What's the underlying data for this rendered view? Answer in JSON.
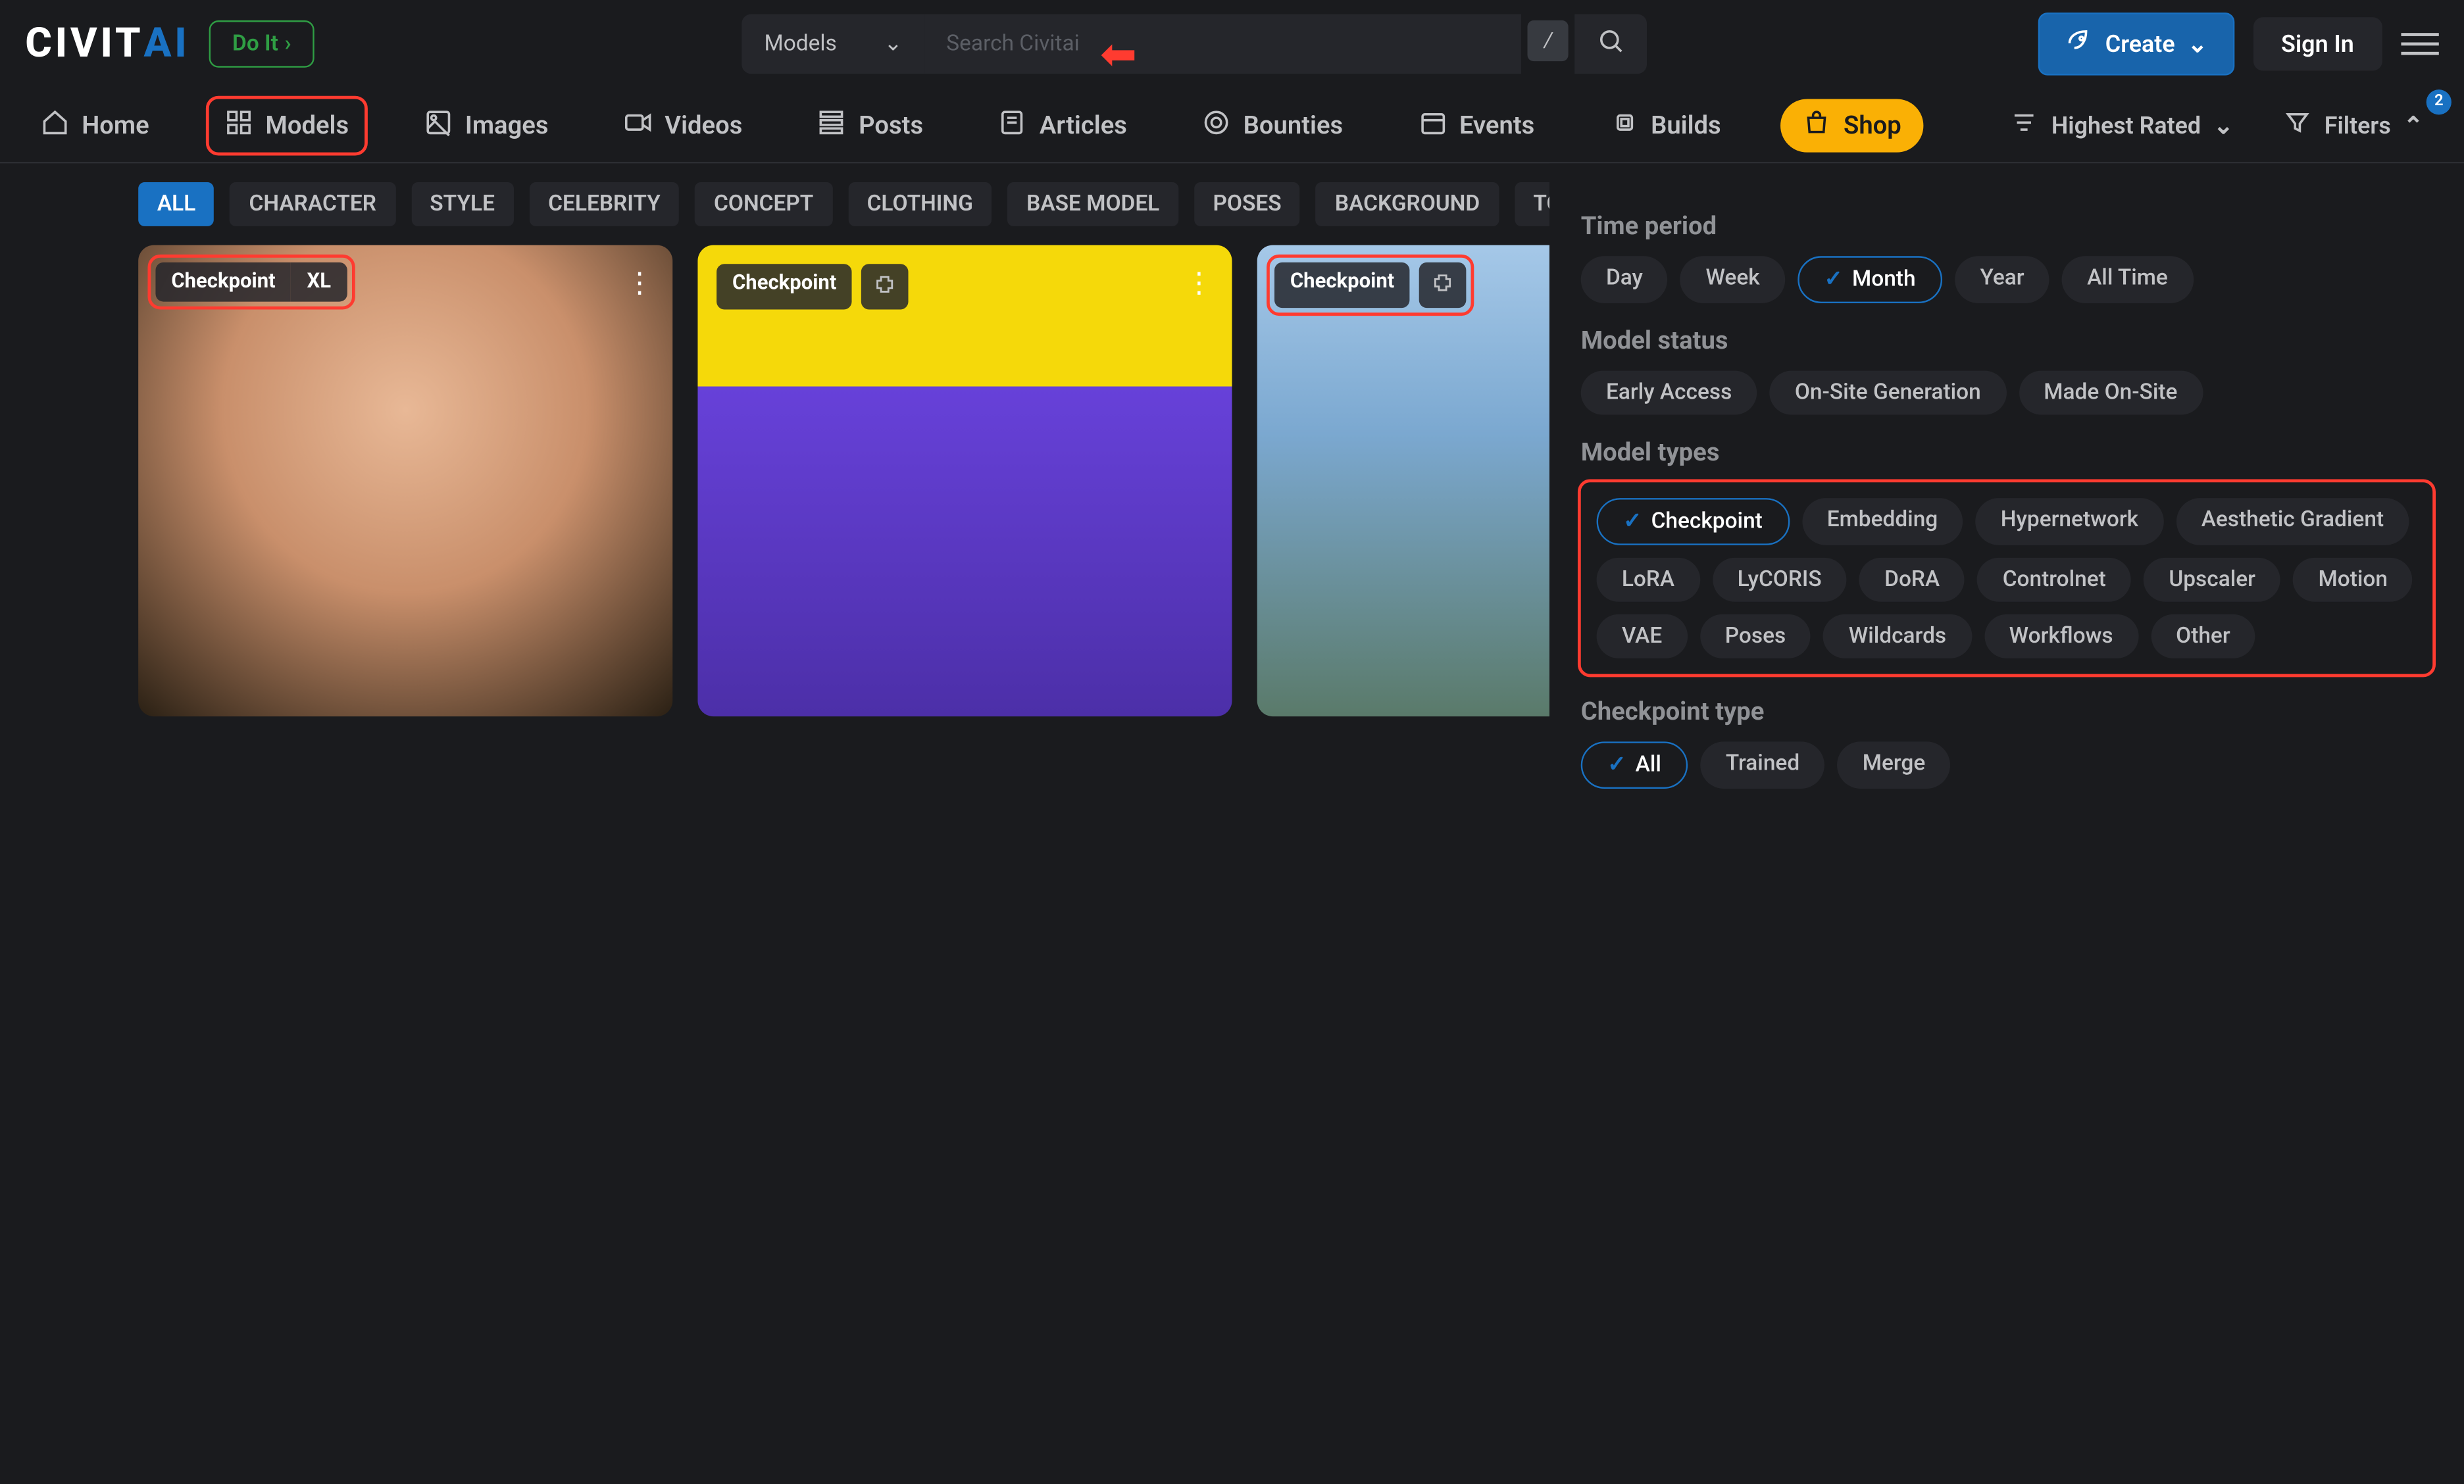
{
  "header": {
    "logo_left": "CIVIT",
    "logo_right": "AI",
    "doit": "Do It",
    "search_type": "Models",
    "search_placeholder": "Search Civitai",
    "slash": "/",
    "create": "Create",
    "signin": "Sign In"
  },
  "nav": {
    "home": "Home",
    "models": "Models",
    "images": "Images",
    "videos": "Videos",
    "posts": "Posts",
    "articles": "Articles",
    "bounties": "Bounties",
    "events": "Events",
    "builds": "Builds",
    "shop": "Shop",
    "sort": "Highest Rated",
    "filters": "Filters",
    "filter_count": "2"
  },
  "tags": {
    "all": "ALL",
    "character": "CHARACTER",
    "style": "STYLE",
    "celebrity": "CELEBRITY",
    "concept": "CONCEPT",
    "clothing": "CLOTHING",
    "base_model": "BASE MODEL",
    "poses": "POSES",
    "background": "BACKGROUND",
    "tool": "TOOL"
  },
  "cards": [
    {
      "badge1": "Checkpoint",
      "badge2": "XL"
    },
    {
      "badge1": "Checkpoint"
    },
    {
      "badge1": "Checkpoint"
    }
  ],
  "filters": {
    "time_title": "Time period",
    "time": {
      "day": "Day",
      "week": "Week",
      "month": "Month",
      "year": "Year",
      "all": "All Time"
    },
    "status_title": "Model status",
    "status": {
      "early": "Early Access",
      "onsite": "On-Site Generation",
      "made": "Made On-Site"
    },
    "types_title": "Model types",
    "types": {
      "checkpoint": "Checkpoint",
      "embedding": "Embedding",
      "hyper": "Hypernetwork",
      "aesthetic": "Aesthetic Gradient",
      "lora": "LoRA",
      "lycoris": "LyCORIS",
      "dora": "DoRA",
      "controlnet": "Controlnet",
      "upscaler": "Upscaler",
      "motion": "Motion",
      "vae": "VAE",
      "poses": "Poses",
      "wildcards": "Wildcards",
      "workflows": "Workflows",
      "other": "Other"
    },
    "ckpt_title": "Checkpoint type",
    "ckpt": {
      "all": "All",
      "trained": "Trained",
      "merge": "Merge"
    }
  }
}
